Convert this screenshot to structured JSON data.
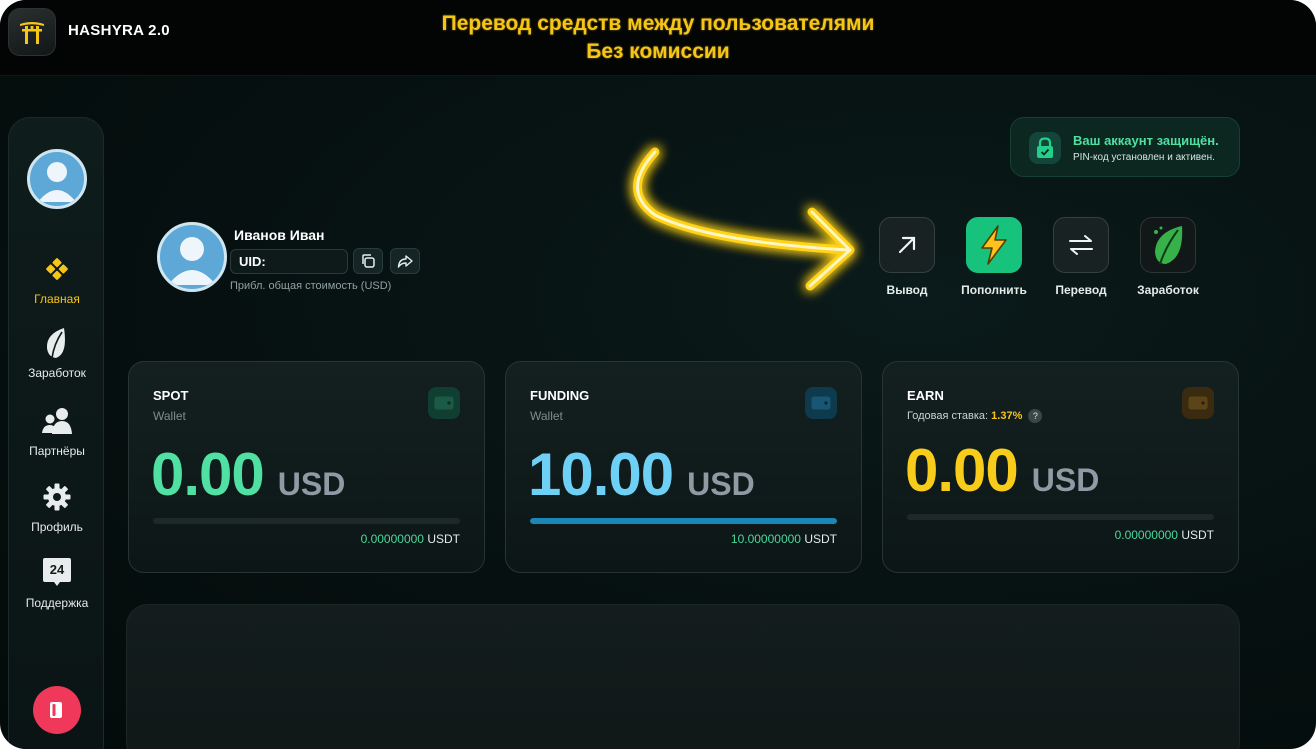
{
  "header": {
    "app_title": "HASHYRA 2.0",
    "banner_line1": "Перевод средств между пользователями",
    "banner_line2": "Без комиссии",
    "logo_icon": "torii-gate-icon"
  },
  "sidebar": {
    "items": [
      {
        "label": "Главная",
        "icon": "diamond-grid-icon",
        "active": true
      },
      {
        "label": "Заработок",
        "icon": "leaf-icon",
        "active": false
      },
      {
        "label": "Партнёры",
        "icon": "partners-icon",
        "active": false
      },
      {
        "label": "Профиль",
        "icon": "gear-icon",
        "active": false
      },
      {
        "label": "Поддержка",
        "icon": "support-24-icon",
        "active": false
      }
    ],
    "support_badge": "24",
    "logout_icon": "logout-icon"
  },
  "security": {
    "title": "Ваш аккаунт защищён.",
    "subtitle": "PIN-код установлен и активен."
  },
  "profile": {
    "name": "Иванов Иван",
    "uid_label": "UID:",
    "uid_value": "",
    "total_label": "Прибл. общая стоимость (USD)"
  },
  "actions": [
    {
      "label": "Вывод",
      "icon": "arrow-up-right-icon"
    },
    {
      "label": "Пополнить",
      "icon": "lightning-icon"
    },
    {
      "label": "Перевод",
      "icon": "transfer-arrows-icon"
    },
    {
      "label": "Заработок",
      "icon": "leaf-icon"
    }
  ],
  "wallets": [
    {
      "title": "SPOT",
      "subtitle": "Wallet",
      "amount": "0.00",
      "unit": "USD",
      "usdt_value": "0.00000000",
      "usdt_unit": "USDT",
      "progress": 0,
      "amount_color": "#4fe0a2"
    },
    {
      "title": "FUNDING",
      "subtitle": "Wallet",
      "amount": "10.00",
      "unit": "USD",
      "usdt_value": "10.00000000",
      "usdt_unit": "USDT",
      "progress": 1,
      "amount_color": "#6fd0f5"
    },
    {
      "title": "EARN",
      "subtitle_label": "Годовая ставка:",
      "rate": "1.37%",
      "help": "?",
      "amount": "0.00",
      "unit": "USD",
      "usdt_value": "0.00000000",
      "usdt_unit": "USDT",
      "progress": 0,
      "amount_color": "#f7cc1a"
    }
  ],
  "colors": {
    "accent_gold": "#f5c518",
    "accent_green": "#17c27c",
    "logout_red": "#f0385a"
  }
}
